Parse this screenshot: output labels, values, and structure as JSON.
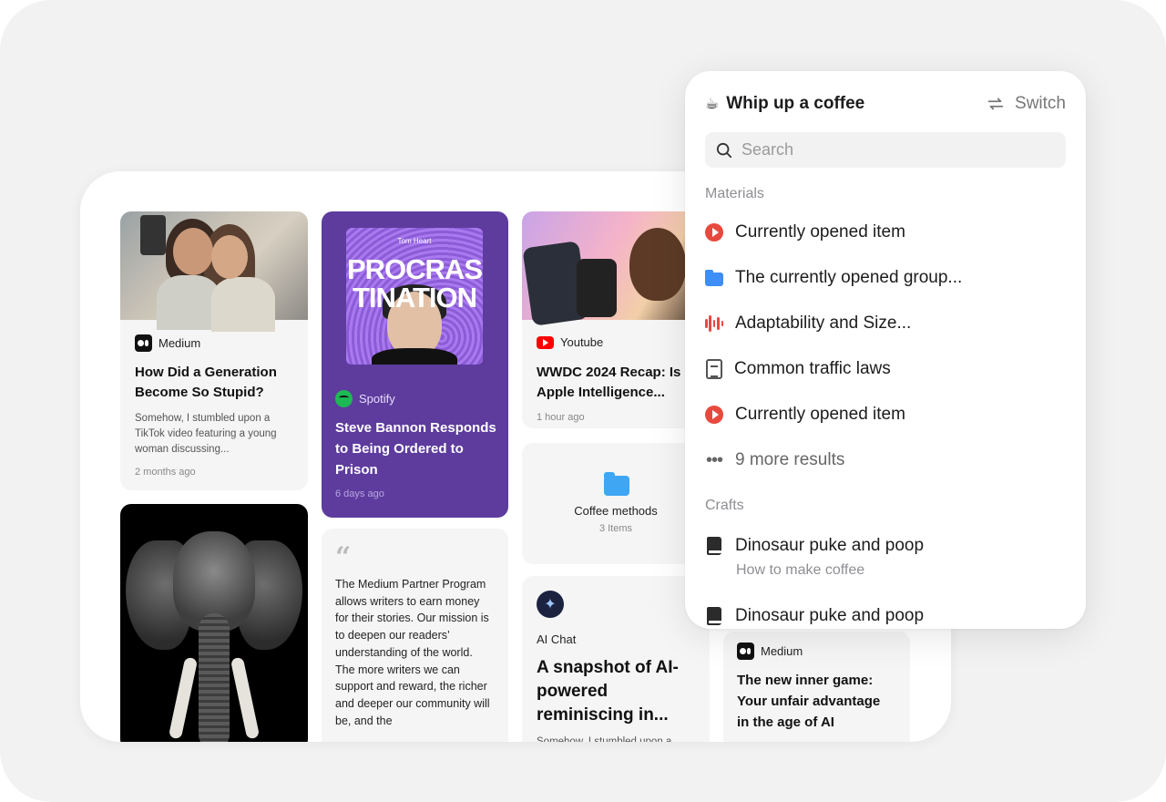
{
  "board": {
    "cards": {
      "medium1": {
        "source": "Medium",
        "title": "How Did a Generation Become So Stupid?",
        "excerpt": "Somehow, I stumbled upon a TikTok video featuring a young woman discussing...",
        "time": "2 months ago"
      },
      "spotify": {
        "cover_author": "Tom Heart",
        "cover_title": "PROCRAS TINATION",
        "source": "Spotify",
        "title": "Steve Bannon Responds to Being Ordered to Prison",
        "time": "6 days ago"
      },
      "quote": {
        "text": "The Medium Partner Program allows writers to earn money for their stories. Our mission is to deepen our readers’ understanding of the world. The more writers we can support and reward, the richer and deeper our community will be, and the"
      },
      "youtube": {
        "source": "Youtube",
        "title": "WWDC 2024 Recap: Is Apple Intelligence...",
        "time": "1 hour ago"
      },
      "folder": {
        "title": "Coffee methods",
        "count": "3 Items"
      },
      "aichat": {
        "source": "AI Chat",
        "title": "A snapshot of AI-powered reminiscing in...",
        "excerpt": "Somehow, I stumbled upon a"
      },
      "medium2": {
        "source": "Medium",
        "title": "The new inner game: Your unfair advantage in the age of AI"
      }
    }
  },
  "popup": {
    "title": "Whip up a coffee",
    "switch_label": "Switch",
    "search_placeholder": "Search",
    "sections": [
      {
        "label": "Materials",
        "items": [
          {
            "label": "Currently opened item",
            "icon": "play-icon"
          },
          {
            "label": "The currently opened group...",
            "icon": "folder-icon"
          },
          {
            "label": "Adaptability and Size...",
            "icon": "audio-icon"
          },
          {
            "label": "Common traffic laws",
            "icon": "note-icon"
          },
          {
            "label": "Currently opened item",
            "icon": "play-icon"
          },
          {
            "label": "9 more results",
            "icon": "more-icon"
          }
        ]
      },
      {
        "label": "Crafts",
        "items": [
          {
            "label": "Dinosaur puke and poop",
            "sub": "How to make coffee",
            "icon": "book-icon"
          },
          {
            "label": "Dinosaur puke and poop",
            "icon": "book-icon"
          }
        ]
      }
    ]
  },
  "colors": {
    "accent_red": "#e8493e",
    "folder_blue": "#3d8ef6",
    "spotify_purple": "#5d3c9e",
    "spotify_green": "#1db954"
  }
}
